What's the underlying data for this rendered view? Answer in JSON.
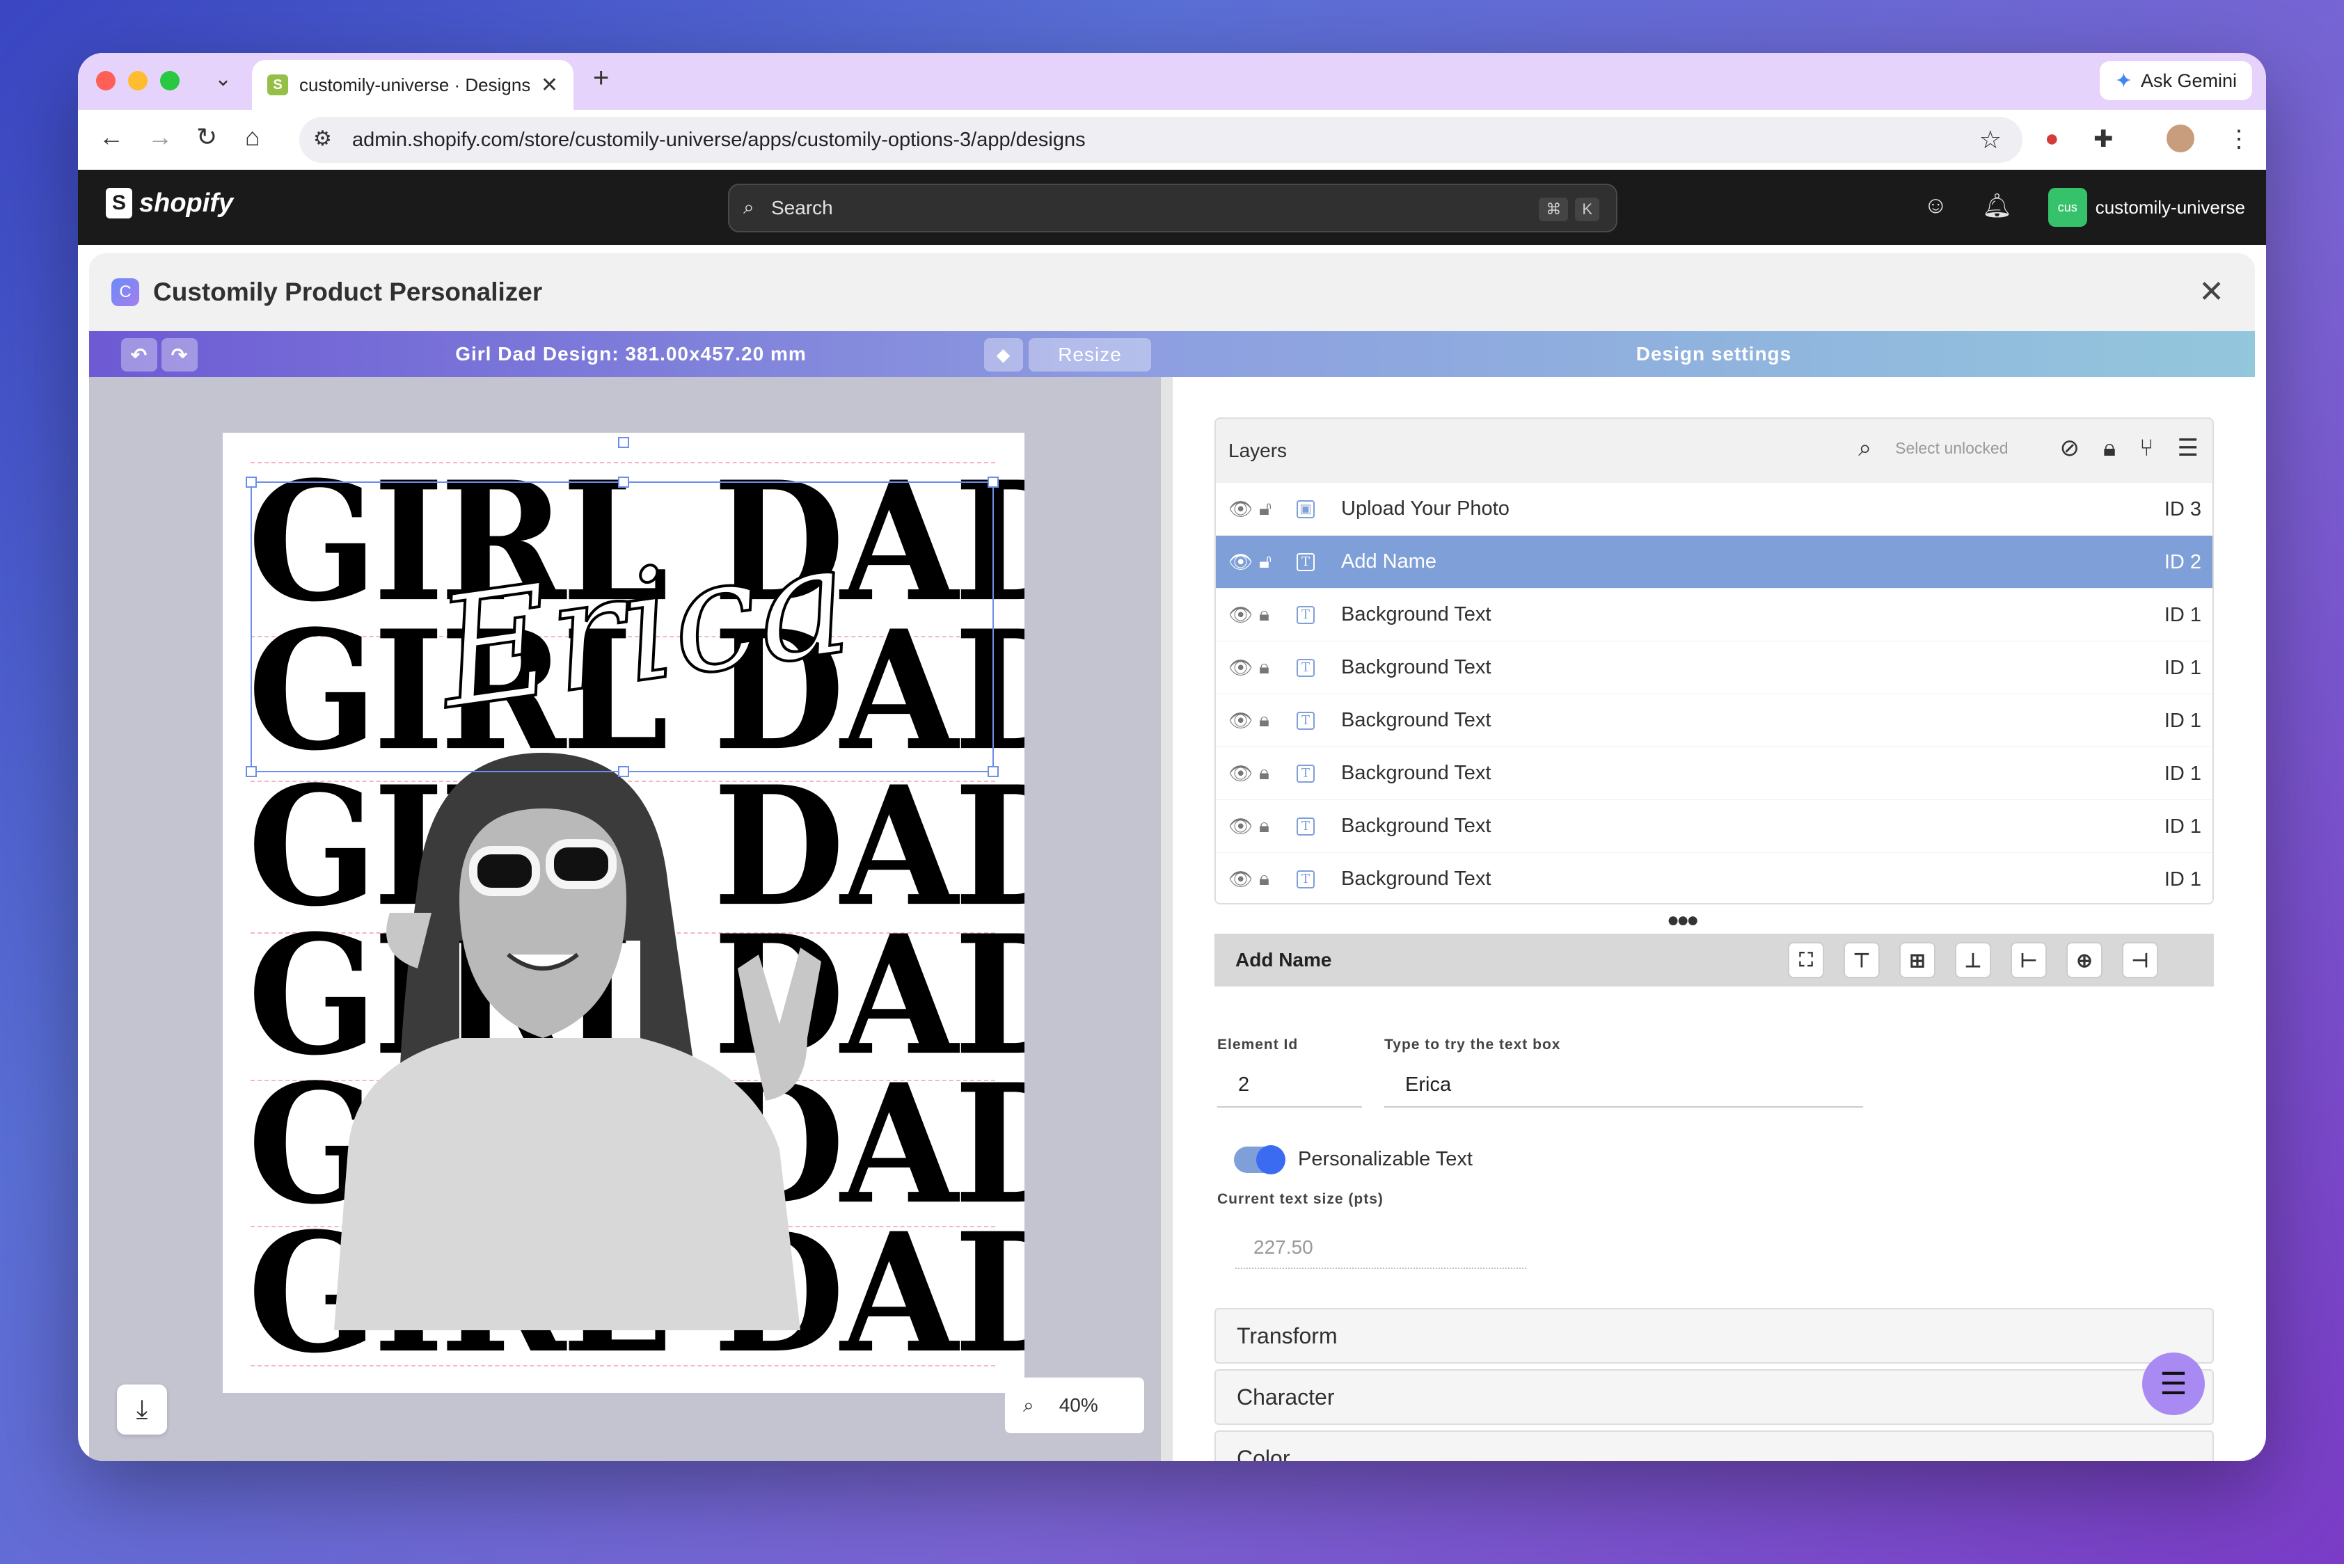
{
  "browser": {
    "tab_title": "customily-universe · Designs",
    "url": "admin.shopify.com/store/customily-universe/apps/customily-options-3/app/designs",
    "ask_gemini": "Ask Gemini"
  },
  "shopify": {
    "logo_text": "shopify",
    "search_placeholder": "Search",
    "shortcut_cmd": "⌘",
    "shortcut_key": "K",
    "store_initials": "cus",
    "store_name": "customily-universe"
  },
  "modal": {
    "title": "Customily Product Personalizer"
  },
  "canvas": {
    "design_title": "Girl Dad Design: 381.00x457.20 mm",
    "resize_label": "Resize",
    "artwork_lines": [
      "GIRL DAD",
      "GIRL DAD",
      "GIRL DAD",
      "GIRL DAD",
      "GIRL DAD",
      "GIRL DAD"
    ],
    "name_text": "Erica",
    "zoom_level": "40%"
  },
  "settings": {
    "header": "Design settings",
    "layers_title": "Layers",
    "select_unlocked": "Select unlocked",
    "layers": [
      {
        "name": "Upload Your Photo",
        "id": "ID 3",
        "locked": false,
        "type": "image"
      },
      {
        "name": "Add Name",
        "id": "ID 2",
        "locked": false,
        "type": "text",
        "active": true
      },
      {
        "name": "Background Text",
        "id": "ID 1",
        "locked": true,
        "type": "text"
      },
      {
        "name": "Background Text",
        "id": "ID 1",
        "locked": true,
        "type": "text"
      },
      {
        "name": "Background Text",
        "id": "ID 1",
        "locked": true,
        "type": "text"
      },
      {
        "name": "Background Text",
        "id": "ID 1",
        "locked": true,
        "type": "text"
      },
      {
        "name": "Background Text",
        "id": "ID 1",
        "locked": true,
        "type": "text"
      },
      {
        "name": "Background Text",
        "id": "ID 1",
        "locked": true,
        "type": "text"
      }
    ],
    "selected_element": "Add Name",
    "element_id_label": "Element Id",
    "element_id_value": "2",
    "try_text_label": "Type to try the text box",
    "try_text_value": "Erica",
    "personalizable_label": "Personalizable Text",
    "personalizable_on": true,
    "text_size_label": "Current text size (pts)",
    "text_size_value": "227.50",
    "sections": [
      "Transform",
      "Character",
      "Color"
    ]
  },
  "colors": {
    "accent": "#7f9fd8",
    "canvas_bar_start": "#6d5ad4",
    "settings_bar_end": "#93c7dc",
    "toggle_on": "#3b6bf0"
  }
}
